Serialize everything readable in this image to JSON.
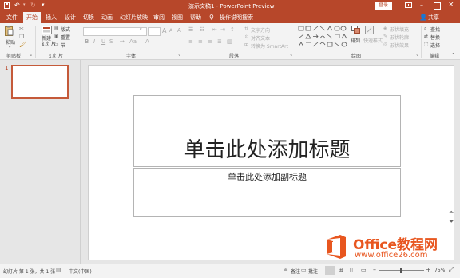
{
  "titlebar": {
    "title": "演示文稿1  -  PowerPoint Preview",
    "login_label": "登录"
  },
  "tabs": [
    {
      "label": "文件"
    },
    {
      "label": "开始"
    },
    {
      "label": "插入"
    },
    {
      "label": "设计"
    },
    {
      "label": "切换"
    },
    {
      "label": "动画"
    },
    {
      "label": "幻灯片放映"
    },
    {
      "label": "审阅"
    },
    {
      "label": "视图"
    },
    {
      "label": "帮助"
    }
  ],
  "search_label": "操作说明搜索",
  "share_label": "共享",
  "ribbon": {
    "paste": "粘贴",
    "clipboard_group": "剪贴板",
    "new_slide": "新建\n幻灯片",
    "layout": "版式",
    "reset": "重置",
    "section": "节",
    "slides_group": "幻灯片",
    "font_group": "字体",
    "text_direction": "文字方向",
    "align_text": "对齐文本",
    "smartart": "转换为 SmartArt",
    "paragraph_group": "段落",
    "arrange": "排列",
    "quick_styles": "快速样式",
    "shape_fill": "形状填充",
    "shape_outline": "形状轮廓",
    "shape_effects": "形状效果",
    "drawing_group": "绘图",
    "find": "查找",
    "replace": "替换",
    "select": "选择",
    "editing_group": "编辑",
    "font_size_a_up": "A",
    "font_size_a_down": "A",
    "bold": "B",
    "italic": "I",
    "underline": "U",
    "strike": "S",
    "clear": "A"
  },
  "thumbs": {
    "slide_number": "1"
  },
  "slide": {
    "title_placeholder": "单击此处添加标题",
    "subtitle_placeholder": "单击此处添加副标题"
  },
  "status": {
    "slide_info": "幻灯片 第 1 张，共 1 张",
    "language": "中文(中国)",
    "notes": "备注",
    "comments": "批注",
    "zoom": "75%"
  },
  "watermark": {
    "brand": "Office教程网",
    "url": "www.office26.com"
  },
  "colors": {
    "accent": "#b7472a",
    "watermark_orange": "#e8561f"
  }
}
